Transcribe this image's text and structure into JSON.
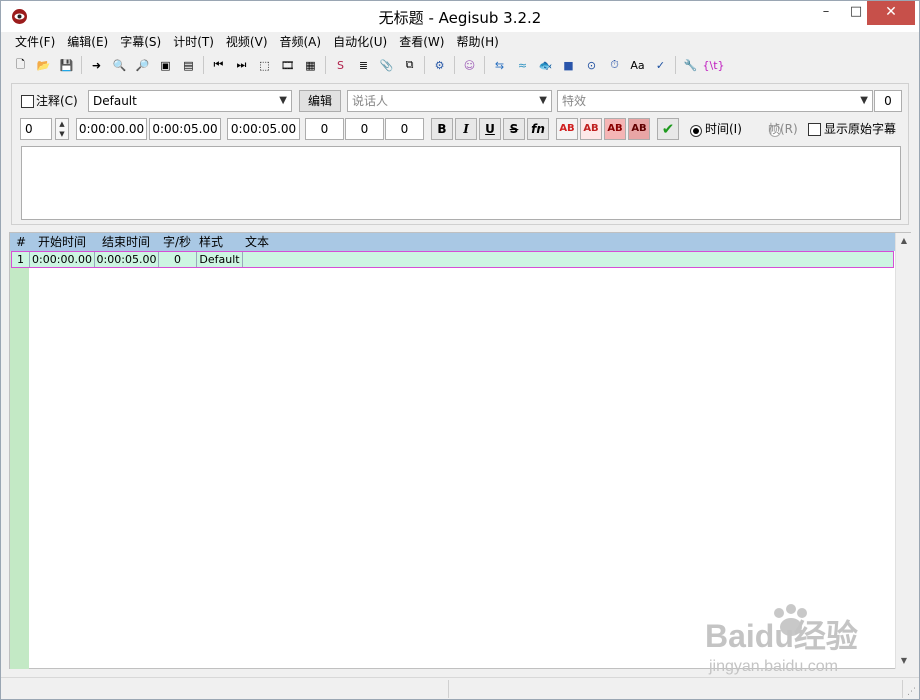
{
  "window": {
    "title": "无标题 - Aegisub 3.2.2",
    "controls": {
      "minimize": "–",
      "maximize": "□",
      "close": "✕"
    }
  },
  "menu": [
    "文件(F)",
    "编辑(E)",
    "字幕(S)",
    "计时(T)",
    "视频(V)",
    "音频(A)",
    "自动化(U)",
    "查看(W)",
    "帮助(H)"
  ],
  "toolbar": {
    "groups": [
      [
        "new-file-icon",
        "open-folder-icon",
        "save-icon"
      ],
      [
        "jump-to-icon",
        "zoom-in-icon",
        "zoom-out-icon",
        "snapshot-icon",
        "snapshot-copy-icon"
      ],
      [
        "video-jump-start-icon",
        "video-jump-end-icon",
        "aspect-ratio-icon",
        "video-details-icon",
        "video-clip-icon"
      ],
      [
        "styles-manager-icon",
        "properties-icon",
        "attachments-icon",
        "fonts-collector-icon"
      ],
      [
        "automation-icon"
      ],
      [
        "assistant-icon"
      ],
      [
        "translation-icon",
        "resample-icon",
        "timing-post-processor-icon",
        "kanji-timer-icon",
        "stop-icon",
        "shift-times-icon",
        "style-assistant-icon",
        "spell-check-icon"
      ],
      [
        "options-icon",
        "tag-toggle-icon"
      ]
    ],
    "glyphs": {
      "new-file-icon": "🗋",
      "open-folder-icon": "📂",
      "save-icon": "💾",
      "jump-to-icon": "➜",
      "zoom-in-icon": "🔍",
      "zoom-out-icon": "🔎",
      "snapshot-icon": "▣",
      "snapshot-copy-icon": "▤",
      "video-jump-start-icon": "⏮",
      "video-jump-end-icon": "⏭",
      "aspect-ratio-icon": "⬚",
      "video-details-icon": "🎞",
      "video-clip-icon": "▦",
      "styles-manager-icon": "S",
      "properties-icon": "≣",
      "attachments-icon": "📎",
      "fonts-collector-icon": "⧉",
      "automation-icon": "⚙",
      "assistant-icon": "☺",
      "translation-icon": "⇆",
      "resample-icon": "≈",
      "timing-post-processor-icon": "🐟",
      "kanji-timer-icon": "■",
      "stop-icon": "⊙",
      "shift-times-icon": "⏱",
      "style-assistant-icon": "Aa",
      "spell-check-icon": "✓",
      "options-icon": "🔧",
      "tag-toggle-icon": "{\\t}"
    }
  },
  "edit": {
    "comment_label": "注释(C)",
    "style_value": "Default",
    "edit_button": "编辑",
    "actor_placeholder": "说话人",
    "effect_placeholder": "特效",
    "layer_right": "0",
    "layer": "0",
    "start_time": "0:00:00.00",
    "end_time": "0:00:05.00",
    "duration": "0:00:05.00",
    "margin_l": "0",
    "margin_r": "0",
    "margin_v": "0",
    "bold": "B",
    "italic": "I",
    "underline": "U",
    "strikeout": "S",
    "font": "fn",
    "color_labels": [
      "AB",
      "AB",
      "AB",
      "AB"
    ],
    "time_radio": "时间(I)",
    "frame_radio": "帧(R)",
    "show_original": "显示原始字幕"
  },
  "grid": {
    "headers": [
      "#",
      "开始时间",
      "结束时间",
      "字/秒",
      "样式",
      "文本"
    ],
    "rows": [
      {
        "num": "1",
        "start": "0:00:00.00",
        "end": "0:00:05.00",
        "cps": "0",
        "style": "Default",
        "text": ""
      }
    ]
  },
  "watermark": {
    "brand": "Baidu经验",
    "url": "jingyan.baidu.com"
  },
  "colors": {
    "grid_header": "#a9c8e4",
    "row_selected": "#cdf5e2",
    "row_border": "#d64fd6",
    "gutter": "#c3e9c5",
    "close_button": "#c7504a"
  }
}
